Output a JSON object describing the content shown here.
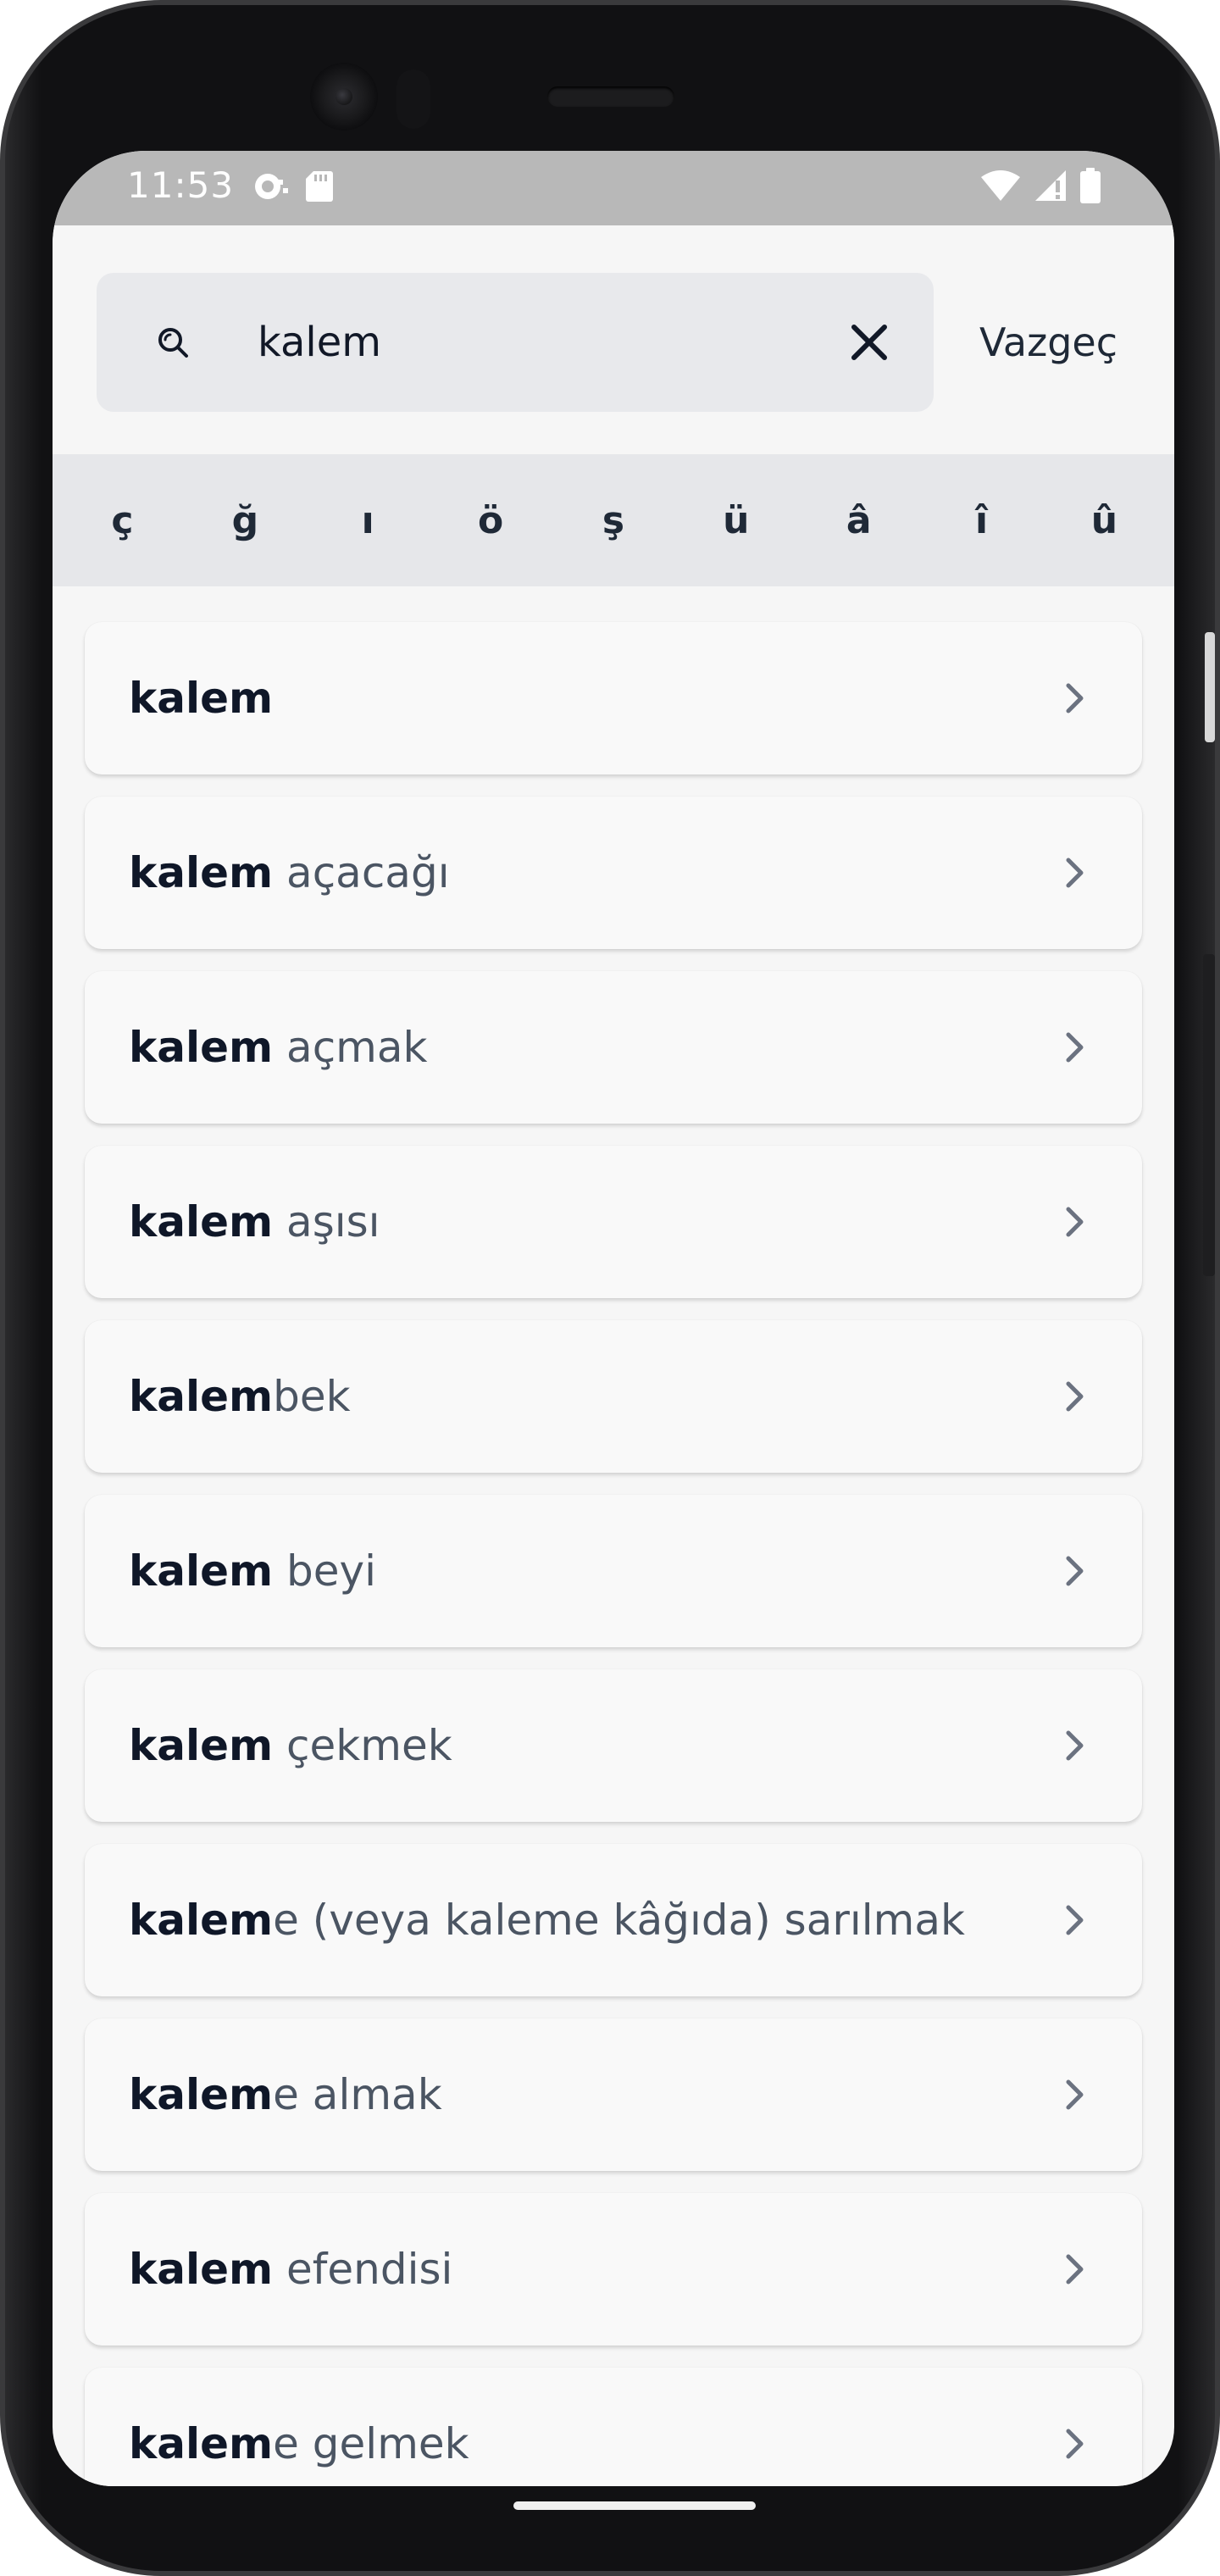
{
  "status_bar": {
    "time": "11:53"
  },
  "search": {
    "query": "kalem",
    "cancel_label": "Vazgeç"
  },
  "special_chars": [
    "ç",
    "ğ",
    "ı",
    "ö",
    "ş",
    "ü",
    "â",
    "î",
    "û"
  ],
  "results": [
    {
      "bold": "kalem",
      "rest": ""
    },
    {
      "bold": "kalem",
      "rest": " açacağı"
    },
    {
      "bold": "kalem",
      "rest": " açmak"
    },
    {
      "bold": "kalem",
      "rest": " aşısı"
    },
    {
      "bold": "kalem",
      "rest": "bek"
    },
    {
      "bold": "kalem",
      "rest": " beyi"
    },
    {
      "bold": "kalem",
      "rest": " çekmek"
    },
    {
      "bold": "kalem",
      "rest": "e (veya kaleme kâğıda) sarılmak"
    },
    {
      "bold": "kalem",
      "rest": "e almak"
    },
    {
      "bold": "kalem",
      "rest": " efendisi"
    },
    {
      "bold": "kalem",
      "rest": "e gelmek"
    }
  ],
  "colors": {
    "screen_bg": "#f6f6f6",
    "status_bar_bg": "#b8b8b8",
    "search_box_bg": "#e8e9ec",
    "char_bar_bg": "#e6e7ea",
    "bold_text": "#0f1728",
    "rest_text": "#4b5563",
    "chevron": "#6b7280"
  }
}
